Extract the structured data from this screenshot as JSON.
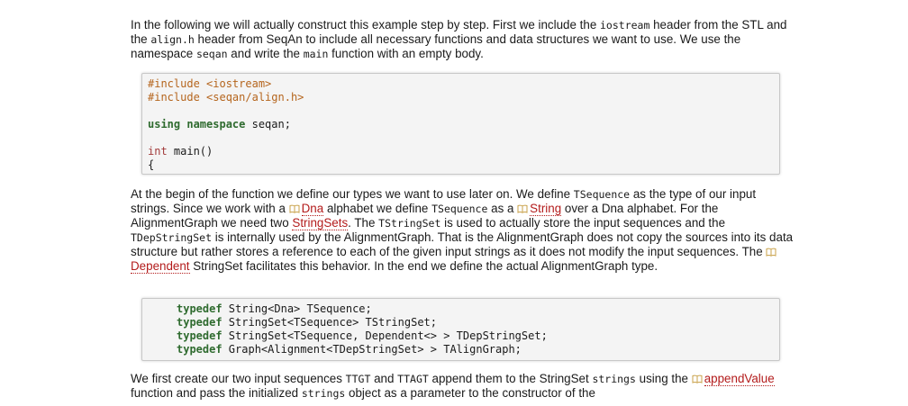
{
  "para1": {
    "t1": "In the following we will actually construct this example step by step. First we include the ",
    "c1": "iostream",
    "t2": " header from the STL and the ",
    "c2": "align.h",
    "t3": " header from SeqAn to include all necessary functions and data structures we want to use. We use the namespace ",
    "c3": "seqan",
    "t4": " and write the ",
    "c4": "main",
    "t5": " function with an empty body."
  },
  "code1": {
    "line1": "#include <iostream>",
    "line2": "#include <seqan/align.h>",
    "line3_kw": "using namespace",
    "line3_rest": " seqan;",
    "line4_kw": "int",
    "line4_rest": " main()",
    "line5": "{"
  },
  "para2": {
    "t1": "At the begin of the function we define our types we want to use later on. We define ",
    "c1": "TSequence",
    "t2": " as the type of our input strings. Since we work with a ",
    "link_dna": "Dna",
    "t3": " alphabet we define ",
    "c2": "TSequence",
    "t4": " as a ",
    "link_string": "String",
    "t5": " over a Dna alphabet. For the AlignmentGraph we need two ",
    "link_stringsets": "StringSets",
    "t6": ". The ",
    "c3": "TStringSet",
    "t7": " is used to actually store the input sequences and the ",
    "c4": "TDepStringSet",
    "t8": " is internally used by the AlignmentGraph. That is the AlignmentGraph does not copy the sources into its data structure but rather stores a reference to each of the given input strings as it does not modify the input sequences. The ",
    "link_dependent": "Dependent",
    "t9": " StringSet facilitates this behavior. In the end we define the actual AlignmentGraph type."
  },
  "code2": {
    "kw": "typedef",
    "l1": " String<Dna> TSequence;",
    "l2": " StringSet<TSequence> TStringSet;",
    "l3": " StringSet<TSequence, Dependent<> > TDepStringSet;",
    "l4": " Graph<Alignment<TDepStringSet> > TAlignGraph;"
  },
  "para3": {
    "t1": "We first create our two input sequences ",
    "c1": "TTGT",
    "t2": " and ",
    "c2": "TTAGT",
    "t3": " append them to the StringSet ",
    "c3": "strings",
    "t4": " using the ",
    "link_append": "appendValue",
    "t5": " function and pass the initialized ",
    "c4": "strings",
    "t6": " object as a parameter to the constructor of the"
  },
  "colors": {
    "link": "#b31b1b",
    "preprocessor": "#b5651d",
    "keyword": "#2f6b2f",
    "type": "#a23b3b",
    "codebox_bg": "#f4f4f4"
  },
  "icons": {
    "link_icon": "book-icon"
  }
}
